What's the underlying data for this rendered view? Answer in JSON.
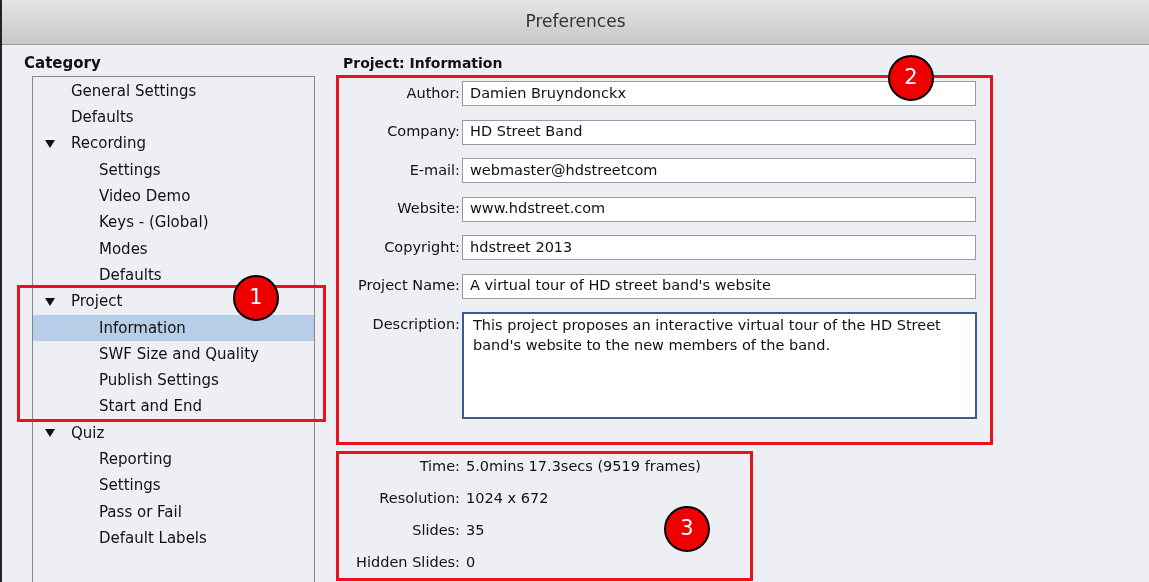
{
  "window": {
    "title": "Preferences"
  },
  "category": {
    "heading": "Category",
    "items": [
      {
        "label": "General Settings",
        "selected": false
      },
      {
        "label": "Defaults",
        "selected": false
      },
      {
        "label": "Recording",
        "selected": false,
        "expanded": true,
        "children": [
          {
            "label": "Settings",
            "selected": false
          },
          {
            "label": "Video Demo",
            "selected": false
          },
          {
            "label": "Keys - (Global)",
            "selected": false
          },
          {
            "label": "Modes",
            "selected": false
          },
          {
            "label": "Defaults",
            "selected": false
          }
        ]
      },
      {
        "label": "Project",
        "selected": false,
        "expanded": true,
        "children": [
          {
            "label": "Information",
            "selected": true
          },
          {
            "label": "SWF Size and Quality",
            "selected": false
          },
          {
            "label": "Publish Settings",
            "selected": false
          },
          {
            "label": "Start and End",
            "selected": false
          }
        ]
      },
      {
        "label": "Quiz",
        "selected": false,
        "expanded": true,
        "children": [
          {
            "label": "Reporting",
            "selected": false
          },
          {
            "label": "Settings",
            "selected": false
          },
          {
            "label": "Pass or Fail",
            "selected": false
          },
          {
            "label": "Default Labels",
            "selected": false
          }
        ]
      }
    ]
  },
  "panel": {
    "heading": "Project: Information",
    "fields": [
      {
        "label": "Author:",
        "value": "Damien Bruyndonckx"
      },
      {
        "label": "Company:",
        "value": "HD Street Band"
      },
      {
        "label": "E-mail:",
        "value": "webmaster@hdstreetcom"
      },
      {
        "label": "Website:",
        "value": "www.hdstreet.com"
      },
      {
        "label": "Copyright:",
        "value": "hdstreet 2013"
      },
      {
        "label": "Project Name:",
        "value": "A virtual tour of HD street band's website"
      }
    ],
    "description": {
      "label": "Description:",
      "value": "This project proposes an interactive virtual tour of the HD Street band's website to the new members of the band."
    },
    "info": [
      {
        "label": "Time:",
        "value": "5.0mins 17.3secs (9519 frames)"
      },
      {
        "label": "Resolution:",
        "value": "1024 x 672"
      },
      {
        "label": "Slides:",
        "value": "35"
      },
      {
        "label": "Hidden Slides:",
        "value": "0"
      }
    ]
  },
  "callouts": [
    {
      "number": "1"
    },
    {
      "number": "2"
    },
    {
      "number": "3"
    }
  ]
}
